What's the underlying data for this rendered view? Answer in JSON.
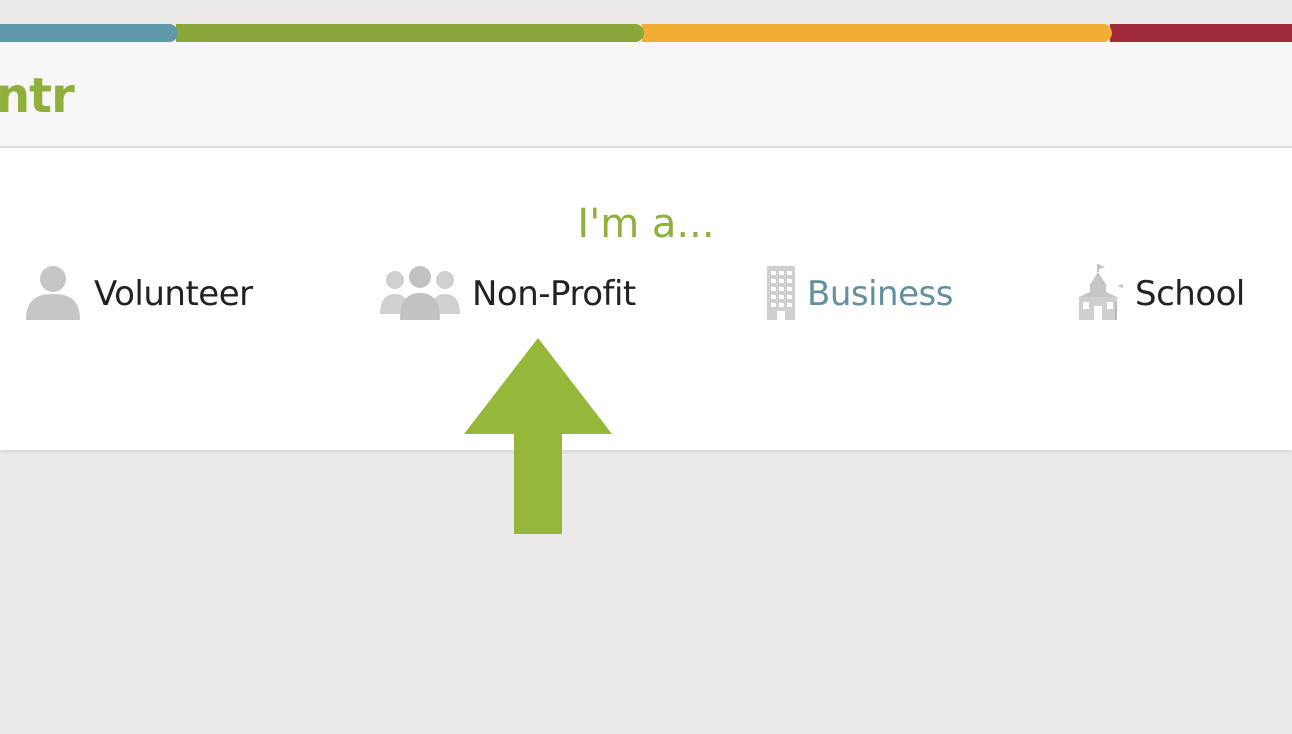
{
  "colors": {
    "stripe": [
      "#5e98a9",
      "#8aa83a",
      "#f2ac33",
      "#9e2a3a"
    ],
    "brand_green": "#8fb03c",
    "link_blue": "#62909d",
    "text_dark": "#222222",
    "icon_gray": "#c6c6c6",
    "arrow_green": "#95b83b"
  },
  "header": {
    "logo_fragment": "ntr"
  },
  "selector": {
    "prompt": "I'm a...",
    "options": [
      {
        "label": "Volunteer",
        "icon": "person-icon"
      },
      {
        "label": "Non-Profit",
        "icon": "group-icon"
      },
      {
        "label": "Business",
        "icon": "building-icon"
      },
      {
        "label": "School",
        "icon": "schoolhouse-icon"
      }
    ]
  }
}
